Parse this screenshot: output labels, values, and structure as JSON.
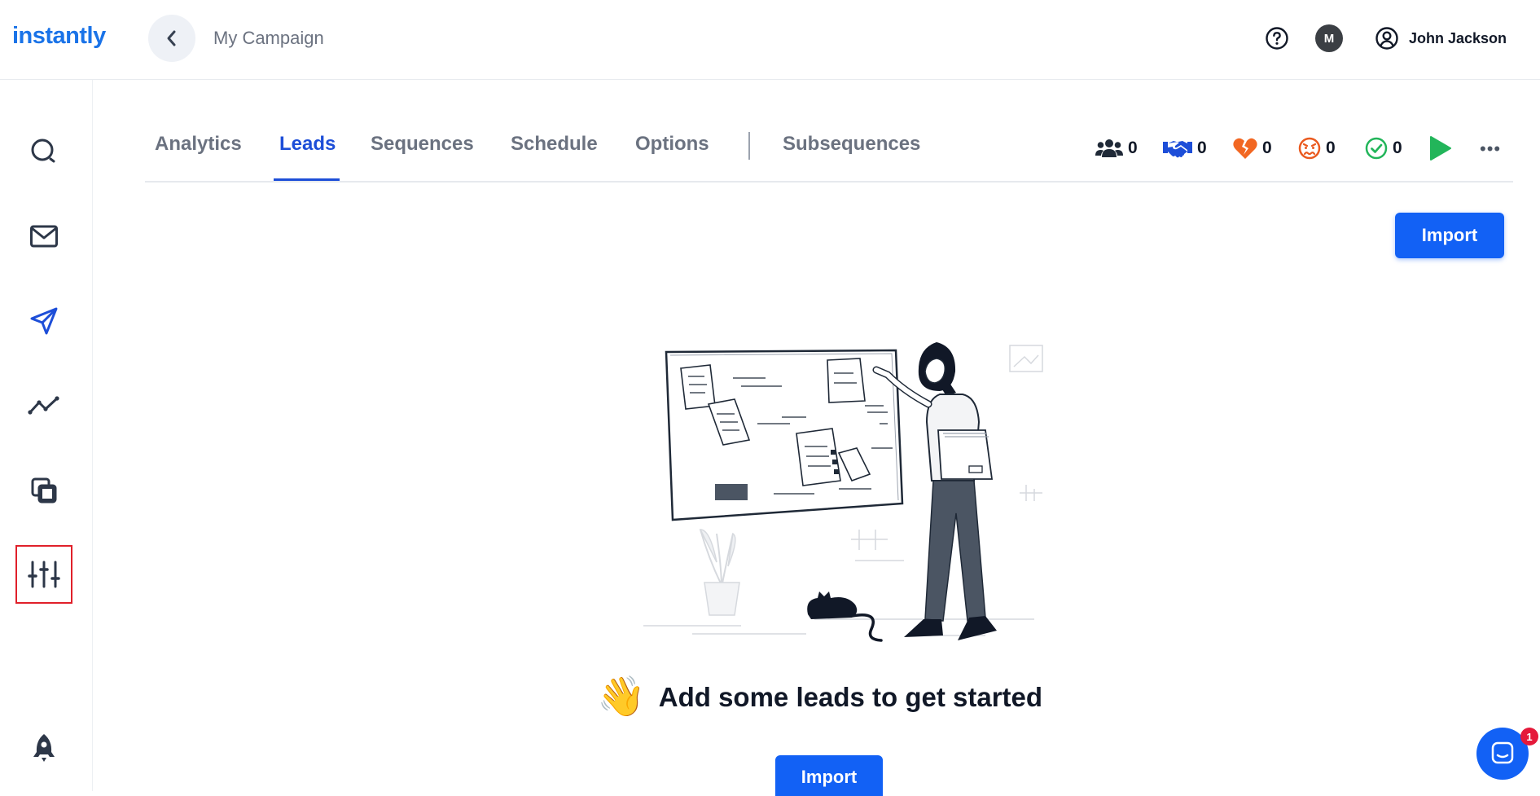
{
  "app": {
    "logo": "instantly"
  },
  "header": {
    "campaign_name": "My Campaign",
    "avatar_initial": "M",
    "user_name": "John Jackson"
  },
  "sidebar": {
    "items": [
      {
        "icon": "search-icon"
      },
      {
        "icon": "mail-icon"
      },
      {
        "icon": "send-icon"
      },
      {
        "icon": "analytics-icon"
      },
      {
        "icon": "copy-icon"
      },
      {
        "icon": "sliders-icon",
        "highlighted": true
      },
      {
        "icon": "rocket-icon"
      }
    ]
  },
  "tabs": [
    {
      "label": "Analytics"
    },
    {
      "label": "Leads",
      "active": true
    },
    {
      "label": "Sequences"
    },
    {
      "label": "Schedule"
    },
    {
      "label": "Options"
    },
    {
      "label": "Subsequences"
    }
  ],
  "stats": [
    {
      "icon": "users-icon",
      "value": "0",
      "color": "#1f2937"
    },
    {
      "icon": "handshake-icon",
      "value": "0",
      "color": "#1d4ed8"
    },
    {
      "icon": "broken-heart-icon",
      "value": "0",
      "color": "#f26722"
    },
    {
      "icon": "angry-face-icon",
      "value": "0",
      "color": "#ea5a1f"
    },
    {
      "icon": "check-circle-icon",
      "value": "0",
      "color": "#22b55a"
    }
  ],
  "actions": {
    "import_top": "Import",
    "import_bottom": "Import"
  },
  "empty_state": {
    "emoji": "👋",
    "message": "Add some leads to get started"
  },
  "chat": {
    "badge_count": "1"
  },
  "colors": {
    "accent": "#1261f5",
    "active_tab": "#1d4ed8",
    "highlight_border": "#e0202a",
    "play": "#22b55a"
  }
}
